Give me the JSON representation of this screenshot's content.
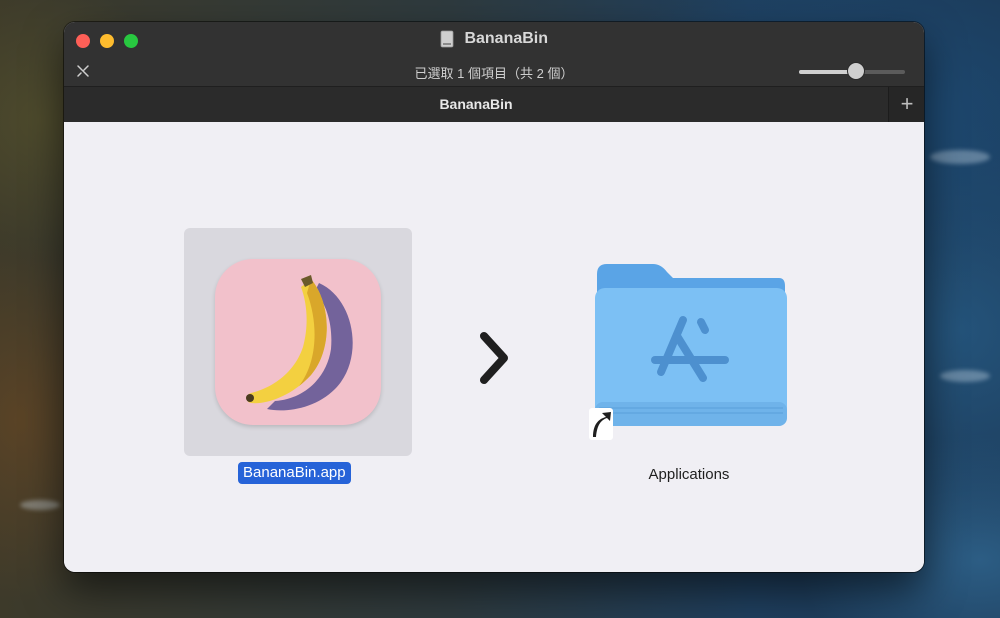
{
  "window": {
    "title": "BananaBin",
    "status": "已選取 1 個項目（共 2 個）",
    "zoom_level": 0.55
  },
  "tabs": [
    {
      "label": "BananaBin"
    }
  ],
  "tab_add_label": "+",
  "items": [
    {
      "name": "BananaBin.app",
      "selected": true,
      "icon": "banana-app-icon"
    },
    {
      "name": "Applications",
      "selected": false,
      "icon": "applications-folder-alias-icon"
    }
  ],
  "colors": {
    "selection": "#2663d8",
    "folder": "#74b8f0",
    "app_icon_bg": "#f2c1cb"
  }
}
